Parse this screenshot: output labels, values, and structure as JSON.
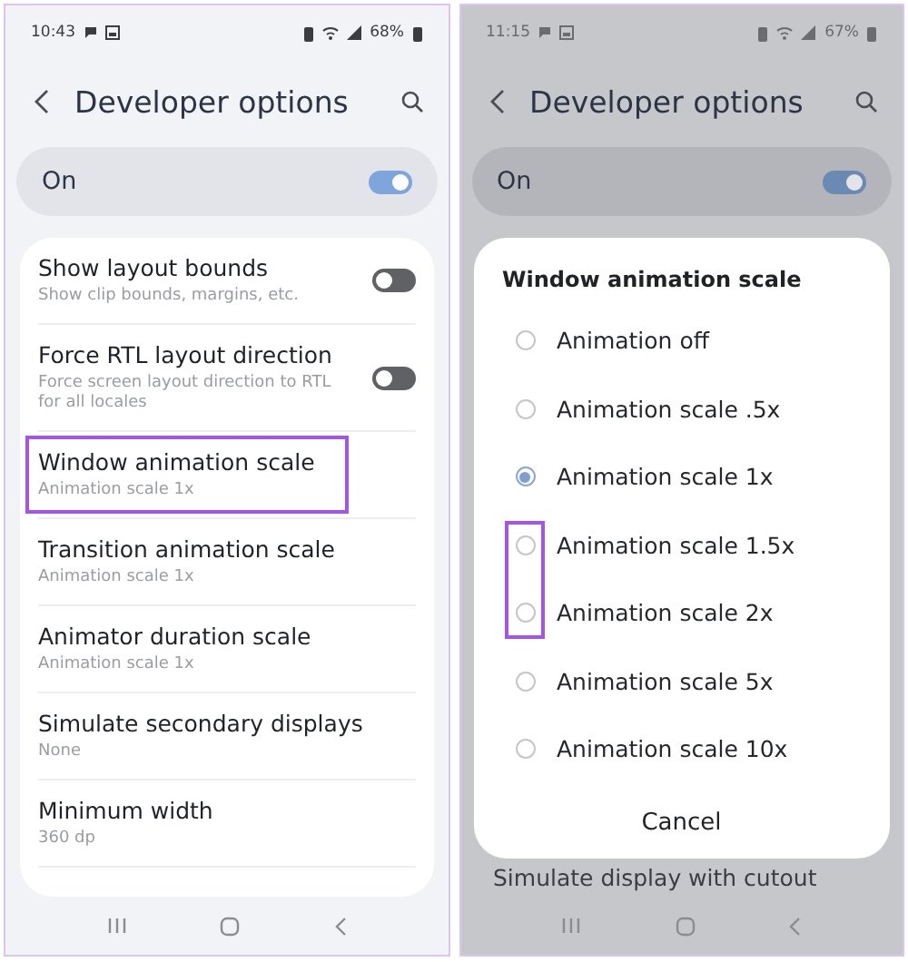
{
  "screens": [
    {
      "status_bar": {
        "time": "10:43",
        "battery": "68%"
      },
      "header": {
        "title": "Developer options"
      },
      "master_switch": {
        "label": "On",
        "on": true
      },
      "settings": [
        {
          "title": "Show layout bounds",
          "subtitle": "Show clip bounds, margins, etc.",
          "kind": "switch",
          "on": false,
          "highlighted": false
        },
        {
          "title": "Force RTL layout direction",
          "subtitle": "Force screen layout direction to RTL for all locales",
          "kind": "switch",
          "on": false,
          "highlighted": false
        },
        {
          "title": "Window animation scale",
          "subtitle": "Animation scale 1x",
          "kind": "value",
          "highlighted": true
        },
        {
          "title": "Transition animation scale",
          "subtitle": "Animation scale 1x",
          "kind": "value",
          "highlighted": false
        },
        {
          "title": "Animator duration scale",
          "subtitle": "Animation scale 1x",
          "kind": "value",
          "highlighted": false
        },
        {
          "title": "Simulate secondary displays",
          "subtitle": "None",
          "kind": "value",
          "highlighted": false
        },
        {
          "title": "Minimum width",
          "subtitle": "360 dp",
          "kind": "value",
          "highlighted": false
        }
      ]
    },
    {
      "status_bar": {
        "time": "11:15",
        "battery": "67%"
      },
      "header": {
        "title": "Developer options"
      },
      "master_switch": {
        "label": "On",
        "on": true
      },
      "settings": [
        {
          "title": "Simulate display with cutout",
          "kind": "value",
          "highlighted": false
        }
      ],
      "dialog": {
        "title": "Window animation scale",
        "options": [
          {
            "label": "Animation off",
            "selected": false,
            "highlighted": false
          },
          {
            "label": "Animation scale .5x",
            "selected": false,
            "highlighted": false
          },
          {
            "label": "Animation scale 1x",
            "selected": true,
            "highlighted": false
          },
          {
            "label": "Animation scale 1.5x",
            "selected": false,
            "highlighted": true
          },
          {
            "label": "Animation scale 2x",
            "selected": false,
            "highlighted": true
          },
          {
            "label": "Animation scale 5x",
            "selected": false,
            "highlighted": false
          },
          {
            "label": "Animation scale 10x",
            "selected": false,
            "highlighted": false
          }
        ],
        "cancel": "Cancel"
      }
    }
  ]
}
